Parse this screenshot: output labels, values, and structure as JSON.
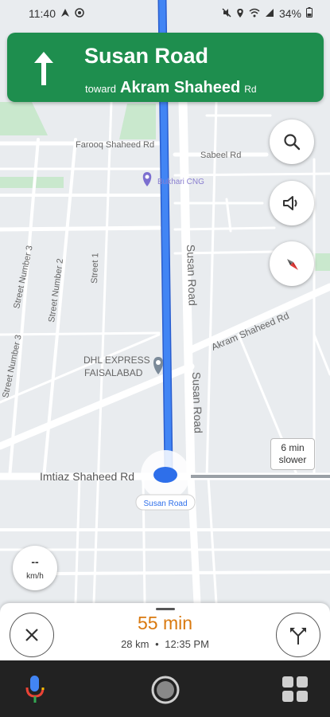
{
  "status_bar": {
    "time": "11:40",
    "battery": "34%",
    "left_icons": [
      "navigation-icon",
      "globe-icon"
    ],
    "right_icons": [
      "mute-icon",
      "location-icon",
      "wifi-icon",
      "signal-icon",
      "battery-icon"
    ]
  },
  "navigation": {
    "street": "Susan Road",
    "toward_word": "toward",
    "toward_street": "Akram Shaheed",
    "toward_suffix": "Rd",
    "maneuver_icon": "arrow-up-icon"
  },
  "map": {
    "labels": {
      "farooq": "Farooq Shaheed Rd",
      "sabeel": "Sabeel Rd",
      "bukhari": "Bukhari CNG",
      "street3a": "Street Number 3",
      "street3b": "Street Number 3",
      "street2": "Street Number 2",
      "street1": "Street 1",
      "susan_upper": "Susan Road",
      "susan_lower": "Susan Road",
      "akram": "Akram Shaheed Rd",
      "dhl1": "DHL EXPRESS",
      "dhl2": "FAISALABAD",
      "imtiaz": "Imtiaz Shaheed Rd",
      "current_road": "Susan Road"
    }
  },
  "callout": {
    "line1": "6 min",
    "line2": "slower"
  },
  "speed": {
    "value": "--",
    "unit": "km/h"
  },
  "trip": {
    "eta": "55 min",
    "distance": "28 km",
    "separator": "•",
    "arrival": "12:35 PM"
  },
  "colors": {
    "banner": "#1e8e4e",
    "route": "#4285f4",
    "eta": "#d9790f",
    "map_bg": "#e9ecef",
    "road": "#ffffff",
    "park": "#c9e8cd"
  }
}
